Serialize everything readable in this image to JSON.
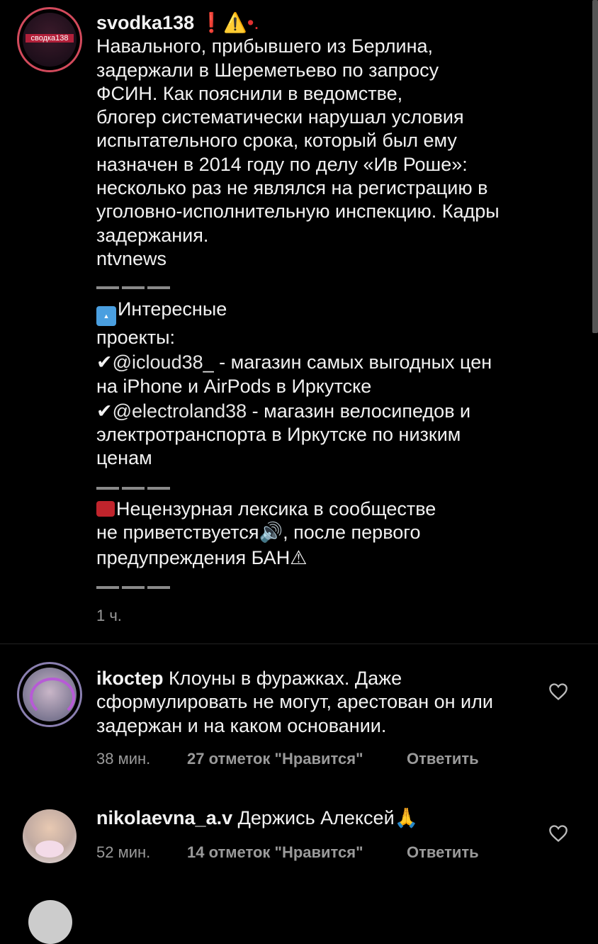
{
  "post": {
    "username": "svodka138",
    "header_suffix": " ❗⚠️•.",
    "avatar_label": "сводка138",
    "lines": [
      "Навального, прибывшего из Берлина,",
      "задержали в Шереметьево по запросу",
      "ФСИН. Как пояснили в ведомстве,",
      "блогер систематически нарушал условия",
      "испытательного срока, который был ему",
      "назначен в 2014 году по делу «Ив Роше»:",
      "несколько раз не являлся на регистрацию в",
      "уголовно-исполнительную инспекцию. Кадры",
      "задержания.",
      "ntvnews"
    ],
    "projects_title": "Интересные",
    "projects_title2": "проекты:",
    "project1_handle": "@icloud38_",
    "project1_text": " - магазин самых выгодных цен",
    "project1_text2": "на iPhone и AirPods в Иркутске",
    "project2_handle": "@electroland38",
    "project2_text": " - магазин велосипедов и",
    "project2_text2": "электротранспорта в Иркутске по низким",
    "project2_text3": "ценам",
    "rules_line1": "Нецензурная лексика в сообществе",
    "rules_line2a": "не приветствуется",
    "rules_line2b": ", после первого",
    "rules_line3": "предупреждения БАН⚠",
    "time": "1 ч."
  },
  "comments": [
    {
      "username": "ikoctep",
      "text1": " Клоуны в фуражках. Даже",
      "text2": "сформулировать не могут, арестован он или",
      "text3": "задержан и на каком основании.",
      "time": "38 мин.",
      "likes": "27 отметок \"Нравится\"",
      "reply": "Ответить"
    },
    {
      "username": "nikolaevna_a.v",
      "text1": " Держись Алексей🙏",
      "time": "52 мин.",
      "likes": "14 отметок \"Нравится\"",
      "reply": "Ответить"
    }
  ],
  "colors": {
    "accent_ring": "#d24a5c",
    "background": "#000000",
    "meta": "#9a9a9a"
  }
}
